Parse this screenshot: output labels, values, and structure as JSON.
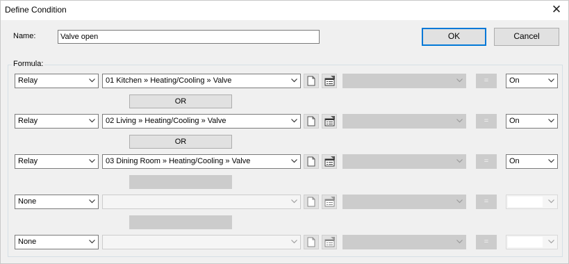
{
  "dialog": {
    "title": "Define Condition",
    "close_icon": "close-x-icon"
  },
  "name_label": "Name:",
  "name_value": "Valve open",
  "ok_label": "OK",
  "cancel_label": "Cancel",
  "formula_label": "Formula:",
  "rows": [
    {
      "type": "Relay",
      "target": "01  Kitchen » Heating/Cooling » Valve",
      "value": "On"
    },
    {
      "type": "Relay",
      "target": "02  Living » Heating/Cooling » Valve",
      "value": "On"
    },
    {
      "type": "Relay",
      "target": "03  Dining Room » Heating/Cooling » Valve",
      "value": "On"
    },
    {
      "type": "None",
      "target": "",
      "value": ""
    },
    {
      "type": "None",
      "target": "",
      "value": ""
    }
  ],
  "operators": [
    "OR",
    "OR",
    "",
    ""
  ],
  "equals_label": "=",
  "icons": {
    "document": "document-icon",
    "properties": "properties-icon",
    "dropdown": "chevron-down-icon"
  }
}
